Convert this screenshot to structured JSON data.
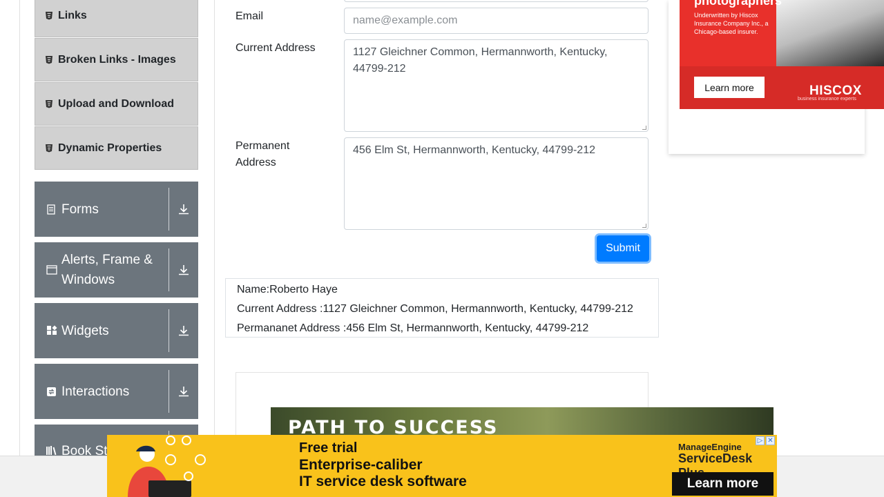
{
  "sidebar": {
    "sub_items": [
      {
        "label": "Links",
        "icon": "element-icon"
      },
      {
        "label": "Broken Links - Images",
        "icon": "element-icon"
      },
      {
        "label": "Upload and Download",
        "icon": "element-icon"
      },
      {
        "label": "Dynamic Properties",
        "icon": "element-icon"
      }
    ],
    "groups": [
      {
        "label": "Forms",
        "icon": "document-icon"
      },
      {
        "label": "Alerts, Frame & Windows",
        "icon": "window-icon"
      },
      {
        "label": "Widgets",
        "icon": "widgets-icon"
      },
      {
        "label": "Interactions",
        "icon": "interactions-icon"
      },
      {
        "label": "Book Store Application",
        "icon": "book-icon"
      }
    ]
  },
  "form": {
    "email_label": "Email",
    "email_placeholder": "name@example.com",
    "current_address_label": "Current Address",
    "current_address_value": "1127 Gleichner Common, Hermannworth, Kentucky, 44799-212",
    "permanent_address_label": "Permanent Address",
    "permanent_address_value": "456 Elm St, Hermannworth, Kentucky, 44799-212",
    "submit_label": "Submit"
  },
  "output": {
    "name": "Name:Roberto Haye",
    "current_address": "Current Address :1127 Gleichner Common, Hermannworth, Kentucky, 44799-212",
    "permanent_address": "Permananet Address :456 Elm St, Hermannworth, Kentucky, 44799-212"
  },
  "ads": {
    "hiscox": {
      "headline": "photographers",
      "description": "Underwritten by Hiscox Insurance Company Inc., a Chicago-based insurer.",
      "cta": "Learn more",
      "brand": "HISCOX",
      "tagline": "business insurance experts"
    },
    "forest": {
      "title": "PATH TO SUCCESS"
    },
    "servicedesk": {
      "line1": "Free trial",
      "line2": "Enterprise-caliber",
      "line3": "IT service desk software",
      "brand_top": "ManageEngine",
      "brand_bottom": "ServiceDesk Plus",
      "cta": "Learn more"
    }
  },
  "colors": {
    "primary": "#007bff",
    "sidebar_group": "#6c757d",
    "sidebar_sub": "#d1d1d1",
    "ad_yellow": "#f9c21b",
    "ad_red": "#e8302b"
  }
}
